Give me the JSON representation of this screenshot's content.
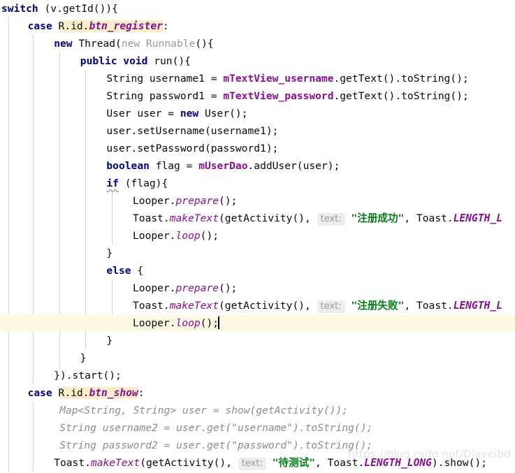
{
  "editor": {
    "language": "java",
    "background": "#ffffff",
    "caret_line_color": "#fdf8e3",
    "search_highlight_color": "#faefc8",
    "indent_guide_color": "#d0d0d0",
    "line_height_px": 25,
    "colors": {
      "keyword": "#000080",
      "plain_text": "#080808",
      "instance_field": "#871094",
      "static_member": "#871094",
      "string_literal": "#067d17",
      "commented_code": "#8c8c8c",
      "inlay_hint_text": "#9a9a9a",
      "inlay_hint_background": "#ededed",
      "greyed_code": "#999999"
    }
  },
  "watermark": {
    "text": "https://blog.csdn.net/Diaveibd"
  },
  "code": {
    "lines": [
      {
        "n": 1,
        "indent": 0,
        "segments": [
          {
            "t": "switch ",
            "c": "kw"
          },
          {
            "t": "(v.getId()){",
            "c": "plain"
          }
        ]
      },
      {
        "n": 2,
        "indent": 1,
        "segments": [
          {
            "t": "case ",
            "c": "kw"
          },
          {
            "t": "R.id.",
            "c": "plain",
            "hl": true
          },
          {
            "t": "btn_register",
            "c": "statb",
            "hl": true
          },
          {
            "t": ":",
            "c": "plain"
          }
        ]
      },
      {
        "n": 3,
        "indent": 2,
        "segments": [
          {
            "t": "new ",
            "c": "kw"
          },
          {
            "t": "Thread(",
            "c": "plain"
          },
          {
            "t": "new ",
            "c": "muted"
          },
          {
            "t": "Runnable",
            "c": "muted"
          },
          {
            "t": "(){",
            "c": "plain"
          }
        ]
      },
      {
        "n": 4,
        "indent": 3,
        "segments": [
          {
            "t": "public void ",
            "c": "kw"
          },
          {
            "t": "run(){",
            "c": "plain"
          }
        ]
      },
      {
        "n": 5,
        "indent": 4,
        "segments": [
          {
            "t": "String username1 = ",
            "c": "plain"
          },
          {
            "t": "mTextView_username",
            "c": "field"
          },
          {
            "t": ".getText().toString();",
            "c": "plain"
          }
        ]
      },
      {
        "n": 6,
        "indent": 4,
        "segments": [
          {
            "t": "String password1 = ",
            "c": "plain"
          },
          {
            "t": "mTextView_password",
            "c": "field"
          },
          {
            "t": ".getText().toString();",
            "c": "plain"
          }
        ]
      },
      {
        "n": 7,
        "indent": 4,
        "segments": [
          {
            "t": "User user = ",
            "c": "plain"
          },
          {
            "t": "new ",
            "c": "kw"
          },
          {
            "t": "User();",
            "c": "plain"
          }
        ]
      },
      {
        "n": 8,
        "indent": 4,
        "segments": [
          {
            "t": "user.setUsername(username1);",
            "c": "plain"
          }
        ]
      },
      {
        "n": 9,
        "indent": 4,
        "segments": [
          {
            "t": "user.setPassword(password1);",
            "c": "plain"
          }
        ]
      },
      {
        "n": 10,
        "indent": 4,
        "segments": [
          {
            "t": "boolean ",
            "c": "kw"
          },
          {
            "t": "flag = ",
            "c": "plain"
          },
          {
            "t": "mUserDao",
            "c": "field"
          },
          {
            "t": ".addUser(user);",
            "c": "plain"
          }
        ]
      },
      {
        "n": 11,
        "indent": 4,
        "segments": [
          {
            "t": "if",
            "c": "kw",
            "squiggly": true
          },
          {
            "t": " (flag){",
            "c": "plain"
          }
        ]
      },
      {
        "n": 12,
        "indent": 5,
        "segments": [
          {
            "t": "Looper.",
            "c": "plain"
          },
          {
            "t": "prepare",
            "c": "static"
          },
          {
            "t": "();",
            "c": "plain"
          }
        ]
      },
      {
        "n": 13,
        "indent": 5,
        "segments": [
          {
            "t": "Toast.",
            "c": "plain"
          },
          {
            "t": "makeText",
            "c": "static"
          },
          {
            "t": "(getActivity(), ",
            "c": "plain"
          },
          {
            "t": "text:",
            "c": "hint"
          },
          {
            "t": " ",
            "c": "plain"
          },
          {
            "t": "\"注册成功\"",
            "c": "str"
          },
          {
            "t": ", Toast.",
            "c": "plain"
          },
          {
            "t": "LENGTH_L",
            "c": "statb"
          }
        ]
      },
      {
        "n": 14,
        "indent": 5,
        "segments": [
          {
            "t": "Looper.",
            "c": "plain"
          },
          {
            "t": "loop",
            "c": "static"
          },
          {
            "t": "();",
            "c": "plain"
          }
        ]
      },
      {
        "n": 15,
        "indent": 4,
        "segments": [
          {
            "t": "}",
            "c": "plain"
          }
        ]
      },
      {
        "n": 16,
        "indent": 4,
        "segments": [
          {
            "t": "else ",
            "c": "kw"
          },
          {
            "t": "{",
            "c": "plain"
          }
        ]
      },
      {
        "n": 17,
        "indent": 5,
        "segments": [
          {
            "t": "Looper.",
            "c": "plain"
          },
          {
            "t": "prepare",
            "c": "static"
          },
          {
            "t": "();",
            "c": "plain"
          }
        ]
      },
      {
        "n": 18,
        "indent": 5,
        "segments": [
          {
            "t": "Toast.",
            "c": "plain"
          },
          {
            "t": "makeText",
            "c": "static"
          },
          {
            "t": "(getActivity(), ",
            "c": "plain"
          },
          {
            "t": "text:",
            "c": "hint"
          },
          {
            "t": " ",
            "c": "plain"
          },
          {
            "t": "\"注册失败\"",
            "c": "str"
          },
          {
            "t": ", Toast.",
            "c": "plain"
          },
          {
            "t": "LENGTH_L",
            "c": "statb"
          }
        ]
      },
      {
        "n": 19,
        "indent": 5,
        "caret": true,
        "segments": [
          {
            "t": "Looper.",
            "c": "plain"
          },
          {
            "t": "loop",
            "c": "static"
          },
          {
            "t": "();",
            "c": "plain"
          },
          {
            "t": "",
            "c": "caret"
          }
        ]
      },
      {
        "n": 20,
        "indent": 4,
        "segments": [
          {
            "t": "}",
            "c": "plain"
          }
        ]
      },
      {
        "n": 21,
        "indent": 3,
        "segments": [
          {
            "t": "}",
            "c": "plain"
          }
        ]
      },
      {
        "n": 22,
        "indent": 2,
        "segments": [
          {
            "t": "}).start();",
            "c": "plain"
          }
        ]
      },
      {
        "n": 23,
        "indent": 1,
        "segments": [
          {
            "t": "case ",
            "c": "kw"
          },
          {
            "t": "R.id.",
            "c": "plain",
            "hl": true
          },
          {
            "t": "btn_show",
            "c": "statb",
            "hl": true
          },
          {
            "t": ":",
            "c": "plain"
          }
        ]
      },
      {
        "n": 24,
        "indent": 2,
        "extra": 8,
        "segments": [
          {
            "t": "Map<String, String> user = show(getActivity());",
            "c": "cmt"
          }
        ]
      },
      {
        "n": 25,
        "indent": 2,
        "extra": 8,
        "segments": [
          {
            "t": "String username2 = user.get(\"username\").toString();",
            "c": "cmt"
          }
        ]
      },
      {
        "n": 26,
        "indent": 2,
        "extra": 8,
        "segments": [
          {
            "t": "String password2 = user.get(\"password\").toString();",
            "c": "cmt"
          }
        ]
      },
      {
        "n": 27,
        "indent": 2,
        "segments": [
          {
            "t": "Toast.",
            "c": "plain"
          },
          {
            "t": "makeText",
            "c": "static"
          },
          {
            "t": "(getActivity(), ",
            "c": "plain"
          },
          {
            "t": "text:",
            "c": "hint"
          },
          {
            "t": " ",
            "c": "plain"
          },
          {
            "t": "\"待测试\"",
            "c": "str"
          },
          {
            "t": ", Toast.",
            "c": "plain"
          },
          {
            "t": "LENGTH_LONG",
            "c": "statb"
          },
          {
            "t": ").show();",
            "c": "plain"
          }
        ]
      }
    ],
    "indent_guides_x": [
      12,
      47,
      85,
      122,
      160,
      197
    ]
  }
}
